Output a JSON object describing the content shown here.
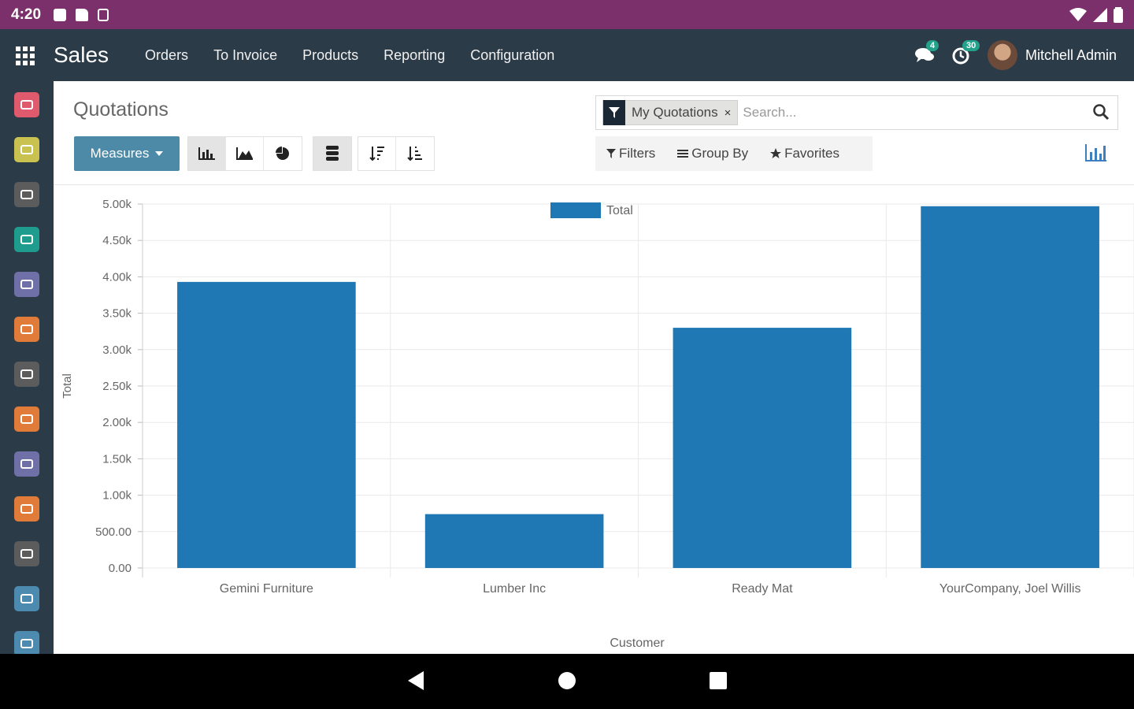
{
  "status_bar": {
    "time": "4:20"
  },
  "navbar": {
    "app_title": "Sales",
    "menu": [
      "Orders",
      "To Invoice",
      "Products",
      "Reporting",
      "Configuration"
    ],
    "messages_count": "4",
    "activities_count": "30",
    "user_name": "Mitchell Admin"
  },
  "sidebar": {
    "apps": [
      {
        "icon": "discuss-icon",
        "color": "#e05a6e"
      },
      {
        "icon": "calendar-icon",
        "color": "#c9c250"
      },
      {
        "icon": "notes-icon",
        "color": "#5c5c5c"
      },
      {
        "icon": "contacts-icon",
        "color": "#1e9c8d"
      },
      {
        "icon": "crm-icon",
        "color": "#7070a8"
      },
      {
        "icon": "sales-icon",
        "color": "#e07b39"
      },
      {
        "icon": "pos-icon",
        "color": "#5c5c5c"
      },
      {
        "icon": "invoicing-icon",
        "color": "#e07b39"
      },
      {
        "icon": "inventory-icon",
        "color": "#7070a8"
      },
      {
        "icon": "website-icon",
        "color": "#e07b39"
      },
      {
        "icon": "marketing-icon",
        "color": "#5c5c5c"
      },
      {
        "icon": "employees-icon",
        "color": "#4d8ab0"
      },
      {
        "icon": "settings-icon",
        "color": "#4d8ab0"
      }
    ]
  },
  "control_panel": {
    "breadcrumb": "Quotations",
    "facet_label": "My Quotations",
    "facet_remove": "×",
    "search_placeholder": "Search...",
    "measures_label": "Measures",
    "filters_label": "Filters",
    "group_by_label": "Group By",
    "favorites_label": "Favorites"
  },
  "colors": {
    "bar": "#1f77b4",
    "primary": "#4d8aa7",
    "navbar": "#2c3b48",
    "status_bar": "#7b2f6b"
  },
  "chart_data": {
    "type": "bar",
    "categories": [
      "Gemini Furniture",
      "Lumber Inc",
      "Ready Mat",
      "YourCompany, Joel Willis"
    ],
    "series": [
      {
        "name": "Total",
        "values": [
          3930,
          740,
          3300,
          4970
        ]
      }
    ],
    "xlabel": "Customer",
    "ylabel": "Total",
    "ylim": [
      0,
      5000
    ],
    "yticks": [
      0,
      500,
      1000,
      1500,
      2000,
      2500,
      3000,
      3500,
      4000,
      4500,
      5000
    ],
    "ytick_labels": [
      "0.00",
      "500.00",
      "1.00k",
      "1.50k",
      "2.00k",
      "2.50k",
      "3.00k",
      "3.50k",
      "4.00k",
      "4.50k",
      "5.00k"
    ],
    "legend_position": "top-center",
    "grid": true
  }
}
